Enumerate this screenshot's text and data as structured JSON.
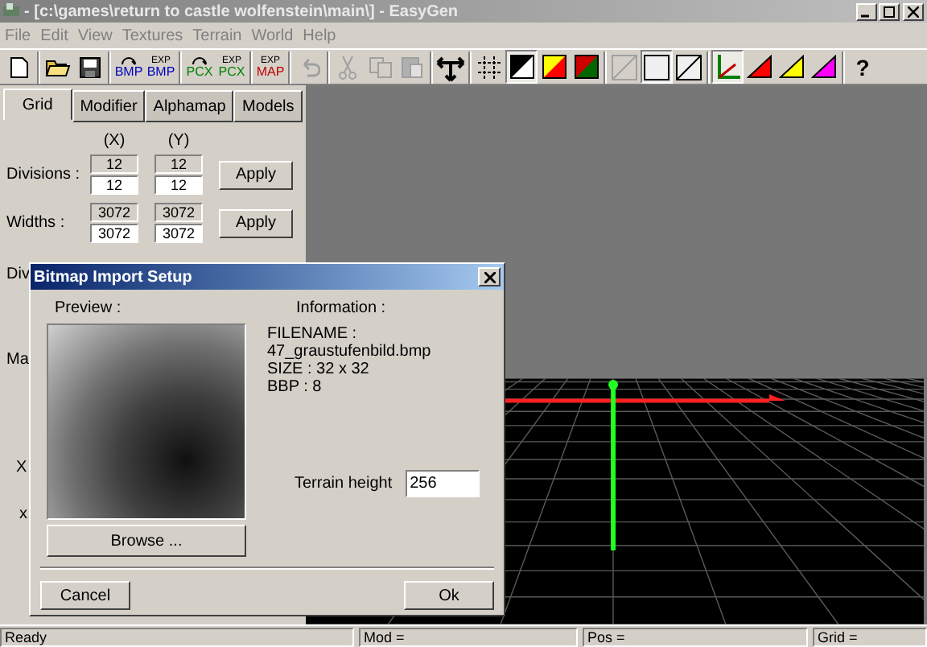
{
  "window": {
    "title": "- [c:\\games\\return to castle wolfenstein\\main\\] - EasyGen"
  },
  "menu": [
    "File",
    "Edit",
    "View",
    "Textures",
    "Terrain",
    "World",
    "Help"
  ],
  "toolbar": [
    {
      "kind": "new",
      "disabled": false,
      "pressed": false
    },
    {
      "kind": "sep"
    },
    {
      "kind": "open",
      "disabled": false,
      "pressed": false
    },
    {
      "kind": "save",
      "disabled": false,
      "pressed": false
    },
    {
      "kind": "sep"
    },
    {
      "kind": "import",
      "label": "BMP",
      "color": "#0000c0",
      "disabled": false,
      "pressed": false
    },
    {
      "kind": "export",
      "top": "EXP",
      "label": "BMP",
      "color": "#0000c0",
      "disabled": false,
      "pressed": false
    },
    {
      "kind": "sep"
    },
    {
      "kind": "import",
      "label": "PCX",
      "color": "#008000",
      "disabled": false,
      "pressed": false
    },
    {
      "kind": "export",
      "top": "EXP",
      "label": "PCX",
      "color": "#008000",
      "disabled": false,
      "pressed": false
    },
    {
      "kind": "sep"
    },
    {
      "kind": "export",
      "top": "EXP",
      "label": "MAP",
      "color": "#c00000",
      "disabled": false,
      "pressed": false
    },
    {
      "kind": "sep"
    },
    {
      "kind": "undo",
      "disabled": true,
      "pressed": false
    },
    {
      "kind": "sep"
    },
    {
      "kind": "cut",
      "disabled": true,
      "pressed": false
    },
    {
      "kind": "copy",
      "disabled": true,
      "pressed": false
    },
    {
      "kind": "paste",
      "disabled": true,
      "pressed": false
    },
    {
      "kind": "sep"
    },
    {
      "kind": "move",
      "disabled": false,
      "pressed": false
    },
    {
      "kind": "sep"
    },
    {
      "kind": "grid",
      "disabled": false,
      "pressed": false
    },
    {
      "kind": "contrast",
      "disabled": false,
      "pressed": true
    },
    {
      "kind": "fire",
      "disabled": false,
      "pressed": false
    },
    {
      "kind": "earth",
      "disabled": false,
      "pressed": false
    },
    {
      "kind": "sep"
    },
    {
      "kind": "diag",
      "disabled": true,
      "pressed": false
    },
    {
      "kind": "square",
      "disabled": false,
      "pressed": true
    },
    {
      "kind": "diag",
      "disabled": false,
      "pressed": false
    },
    {
      "kind": "sep"
    },
    {
      "kind": "axes",
      "disabled": false,
      "pressed": true
    },
    {
      "kind": "triangle",
      "color": "#ff0000",
      "disabled": false,
      "pressed": false
    },
    {
      "kind": "triangle",
      "color": "#ffff00",
      "disabled": false,
      "pressed": false
    },
    {
      "kind": "triangle",
      "color": "#ff00ff",
      "disabled": false,
      "pressed": false
    },
    {
      "kind": "sep"
    },
    {
      "kind": "help",
      "label": "?",
      "disabled": false,
      "pressed": false
    }
  ],
  "tabs": [
    {
      "label": "Grid",
      "selected": true
    },
    {
      "label": "Modifier",
      "selected": false
    },
    {
      "label": "Alphamap",
      "selected": false
    },
    {
      "label": "Models",
      "selected": false
    }
  ],
  "grid_panel": {
    "x_header": "(X)",
    "y_header": "(Y)",
    "rows": [
      {
        "label": "Divisions :",
        "x_current": "12",
        "y_current": "12",
        "x_value": "12",
        "y_value": "12",
        "button": "Apply"
      },
      {
        "label": "Widths :",
        "x_current": "3072",
        "y_current": "3072",
        "x_value": "3072",
        "y_value": "3072",
        "button": "Apply"
      }
    ],
    "hidden_labels": [
      "Div",
      "Ma"
    ],
    "hidden_fragments": [
      "X",
      "x"
    ]
  },
  "dialog": {
    "title": "Bitmap Import Setup",
    "preview_label": "Preview :",
    "info_label": "Information :",
    "info_lines": [
      "FILENAME : 47_graustufenbild.bmp",
      "SIZE : 32 x 32",
      "BBP : 8"
    ],
    "terrain_height": {
      "label": "Terrain height",
      "value": "256"
    },
    "browse": "Browse ...",
    "cancel": "Cancel",
    "ok": "Ok"
  },
  "status_bar": [
    "Ready",
    "Mod =",
    "Pos =",
    "Grid ="
  ]
}
